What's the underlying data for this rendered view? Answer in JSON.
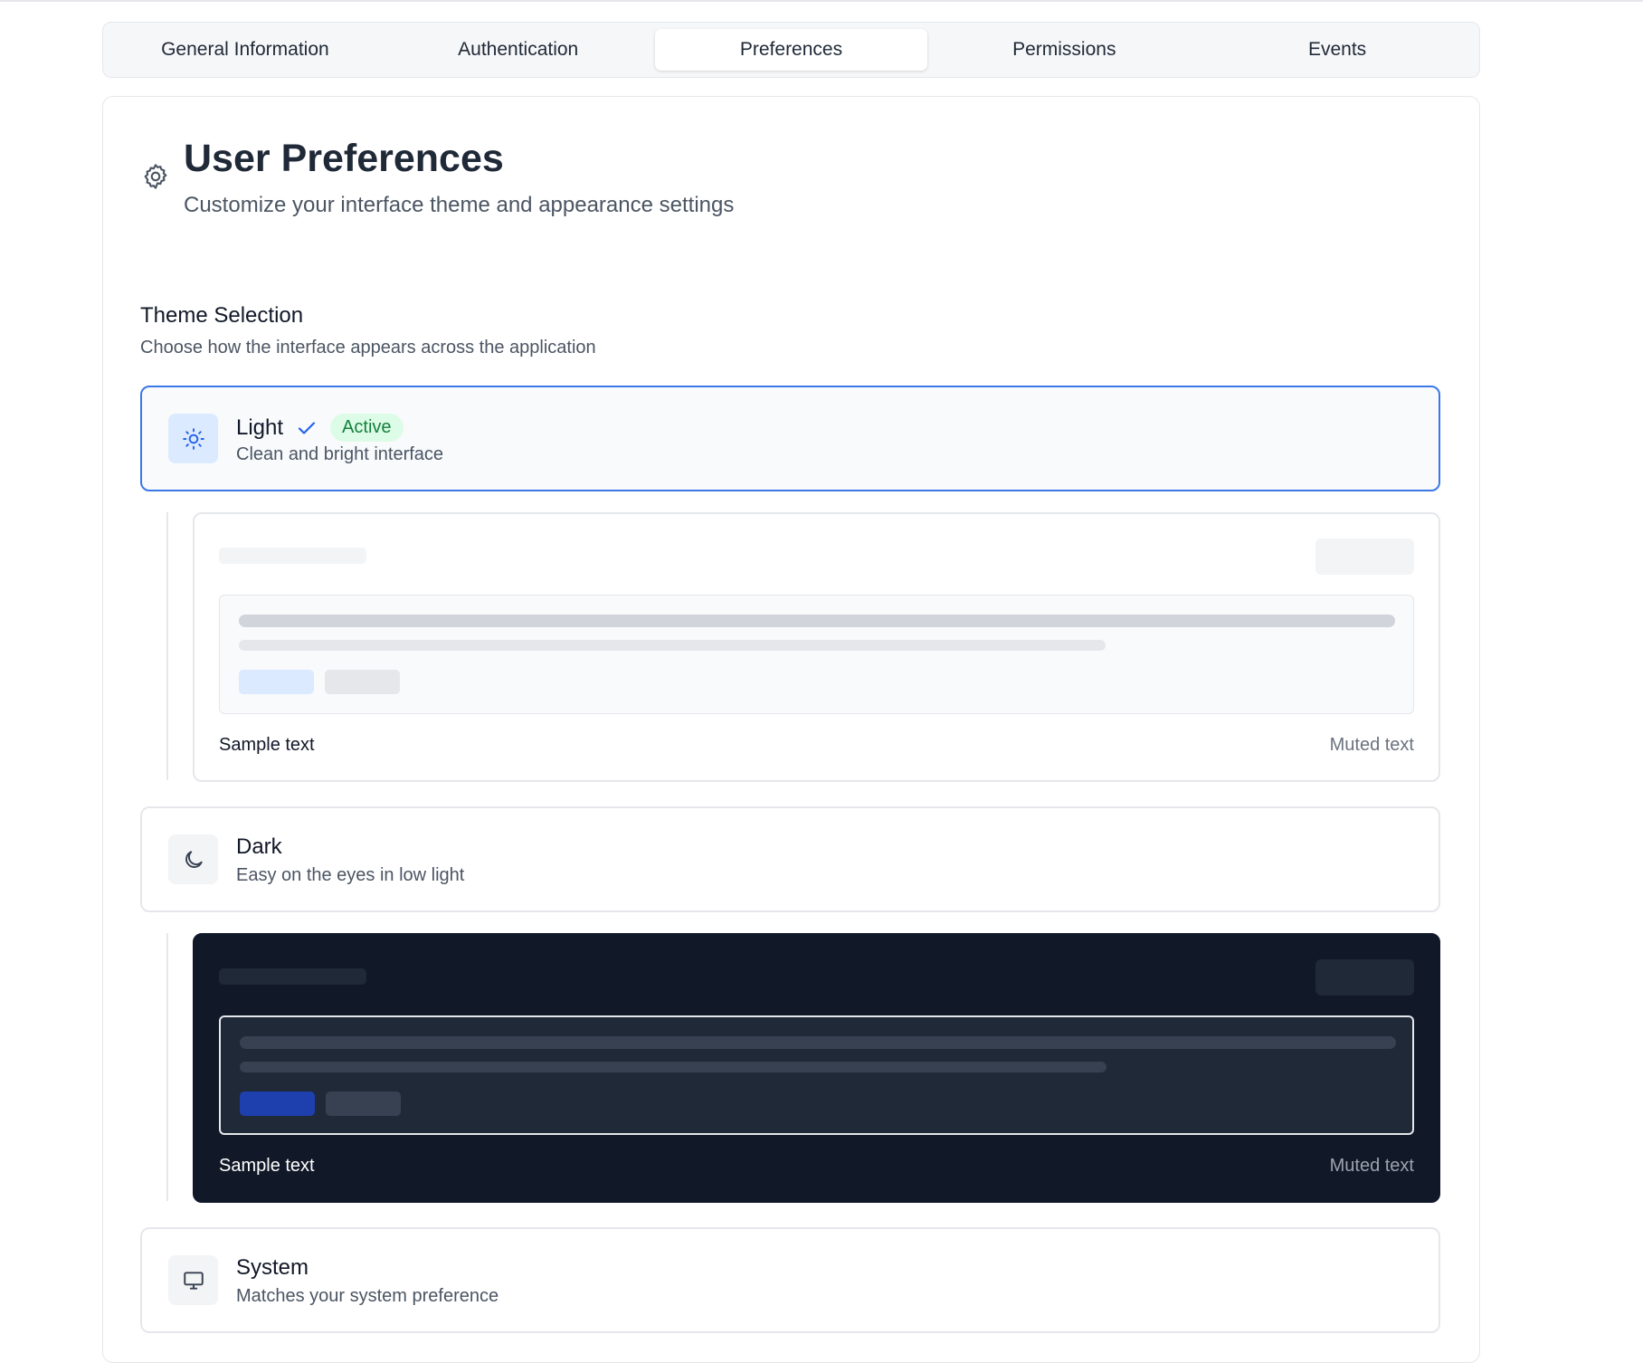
{
  "tabs": [
    {
      "label": "General Information",
      "active": false
    },
    {
      "label": "Authentication",
      "active": false
    },
    {
      "label": "Preferences",
      "active": true
    },
    {
      "label": "Permissions",
      "active": false
    },
    {
      "label": "Events",
      "active": false
    }
  ],
  "header": {
    "icon": "gear-icon",
    "title": "User Preferences",
    "subtitle": "Customize your interface theme and appearance settings"
  },
  "theme_section": {
    "title": "Theme Selection",
    "description": "Choose how the interface appears across the application",
    "options": [
      {
        "name": "Light",
        "description": "Clean and bright interface",
        "icon": "sun-icon",
        "selected": true,
        "badge": "Active",
        "preview": {
          "sample_text": "Sample text",
          "muted_text": "Muted text"
        }
      },
      {
        "name": "Dark",
        "description": "Easy on the eyes in low light",
        "icon": "moon-icon",
        "selected": false,
        "preview": {
          "sample_text": "Sample text",
          "muted_text": "Muted text"
        }
      },
      {
        "name": "System",
        "description": "Matches your system preference",
        "icon": "monitor-icon",
        "selected": false
      }
    ]
  },
  "colors": {
    "accent": "#3b78e7",
    "active_badge_bg": "#dcfce7",
    "active_badge_text": "#15803d",
    "dark_preview_bg": "#111827"
  }
}
